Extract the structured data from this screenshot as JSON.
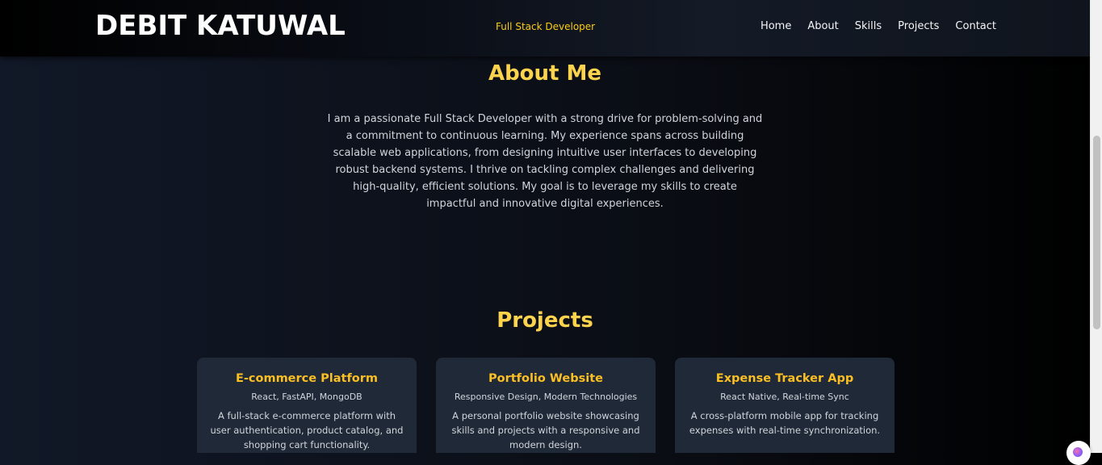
{
  "header": {
    "brand": "DEBIT KATUWAL",
    "tagline": "Full Stack Developer",
    "nav": [
      "Home",
      "About",
      "Skills",
      "Projects",
      "Contact"
    ]
  },
  "about": {
    "title": "About Me",
    "text": "I am a passionate Full Stack Developer with a strong drive for problem-solving and a commitment to continuous learning. My experience spans across building scalable web applications, from designing intuitive user interfaces to developing robust backend systems. I thrive on tackling complex challenges and delivering high-quality, efficient solutions. My goal is to leverage my skills to create impactful and innovative digital experiences."
  },
  "projects": {
    "title": "Projects",
    "items": [
      {
        "title": "E-commerce Platform",
        "tech": "React, FastAPI, MongoDB",
        "description": "A full-stack e-commerce platform with user authentication, product catalog, and shopping cart functionality."
      },
      {
        "title": "Portfolio Website",
        "tech": "Responsive Design, Modern Technologies",
        "description": "A personal portfolio website showcasing skills and projects with a responsive and modern design."
      },
      {
        "title": "Expense Tracker App",
        "tech": "React Native, Real-time Sync",
        "description": "A cross-platform mobile app for tracking expenses with real-time synchronization."
      }
    ]
  },
  "colors": {
    "accent": "#facc15",
    "heading": "#fcd34d",
    "card_background": "#1f2937",
    "page_background": "#111827"
  },
  "icons": {
    "corner_badge": "assistant-orb-icon"
  }
}
